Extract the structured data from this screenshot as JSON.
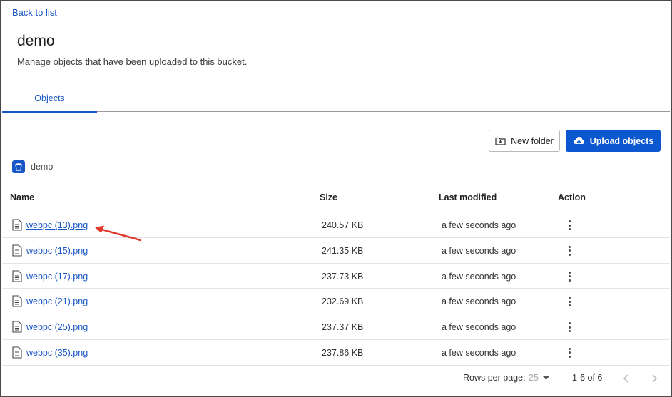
{
  "nav": {
    "back_label": "Back to list"
  },
  "header": {
    "title": "demo",
    "subtitle": "Manage objects that have been uploaded to this bucket."
  },
  "tabs": [
    {
      "label": "Objects",
      "active": true
    }
  ],
  "toolbar": {
    "new_folder_label": "New folder",
    "upload_label": "Upload objects"
  },
  "breadcrumb": {
    "bucket": "demo"
  },
  "table": {
    "columns": [
      "Name",
      "Size",
      "Last modified",
      "Action"
    ],
    "rows": [
      {
        "name": "webpc (13).png",
        "size": "240.57 KB",
        "modified": "a few seconds ago"
      },
      {
        "name": "webpc (15).png",
        "size": "241.35 KB",
        "modified": "a few seconds ago"
      },
      {
        "name": "webpc (17).png",
        "size": "237.73 KB",
        "modified": "a few seconds ago"
      },
      {
        "name": "webpc (21).png",
        "size": "232.69 KB",
        "modified": "a few seconds ago"
      },
      {
        "name": "webpc (25).png",
        "size": "237.37 KB",
        "modified": "a few seconds ago"
      },
      {
        "name": "webpc (35).png",
        "size": "237.86 KB",
        "modified": "a few seconds ago"
      }
    ]
  },
  "pagination": {
    "rows_per_page_label": "Rows per page:",
    "rows_per_page_value": "25",
    "range": "1-6 of 6"
  },
  "colors": {
    "accent": "#0b57d0",
    "link": "#1a57c6",
    "annotation_arrow": "#e03a2f"
  }
}
